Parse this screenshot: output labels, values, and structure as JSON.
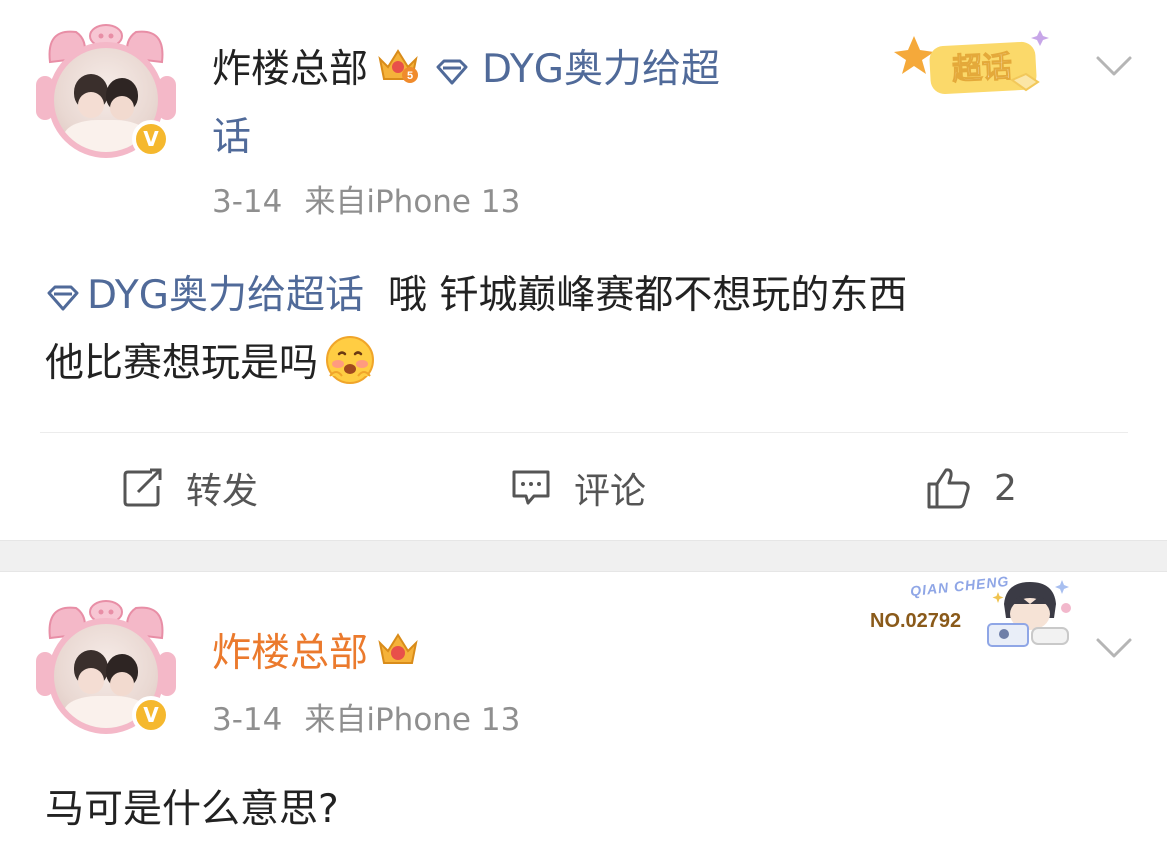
{
  "posts": [
    {
      "username": "炸楼总部",
      "crown_level": "5",
      "topic_prefix": "DYG奥力给超",
      "topic_suffix": "话",
      "date": "3-14",
      "source": "来自iPhone 13",
      "supertopic_tag": "超话",
      "body_topic": "DYG奥力给超话",
      "body_line1": "哦 钎城巅峰赛都不想玩的东西",
      "body_line2": "他比赛想玩是吗",
      "actions": {
        "repost": "转发",
        "comment": "评论",
        "like_count": "2"
      }
    },
    {
      "username": "炸楼总部",
      "date": "3-14",
      "source": "来自iPhone 13",
      "fan_number": "NO.02792",
      "fan_script": "QIAN CHENG",
      "body": "马可是什么意思?"
    }
  ],
  "icons": [
    "avatar",
    "verified-badge",
    "crown-badge",
    "diamond-topic-icon",
    "chevron-down-icon",
    "repost-icon",
    "comment-icon",
    "like-icon",
    "blushing-emoji"
  ],
  "colors": {
    "topic_link": "#506a99",
    "username_orange": "#eb7a2d",
    "meta_gray": "#8f8f8f",
    "verified_yellow": "#f5b82e"
  }
}
